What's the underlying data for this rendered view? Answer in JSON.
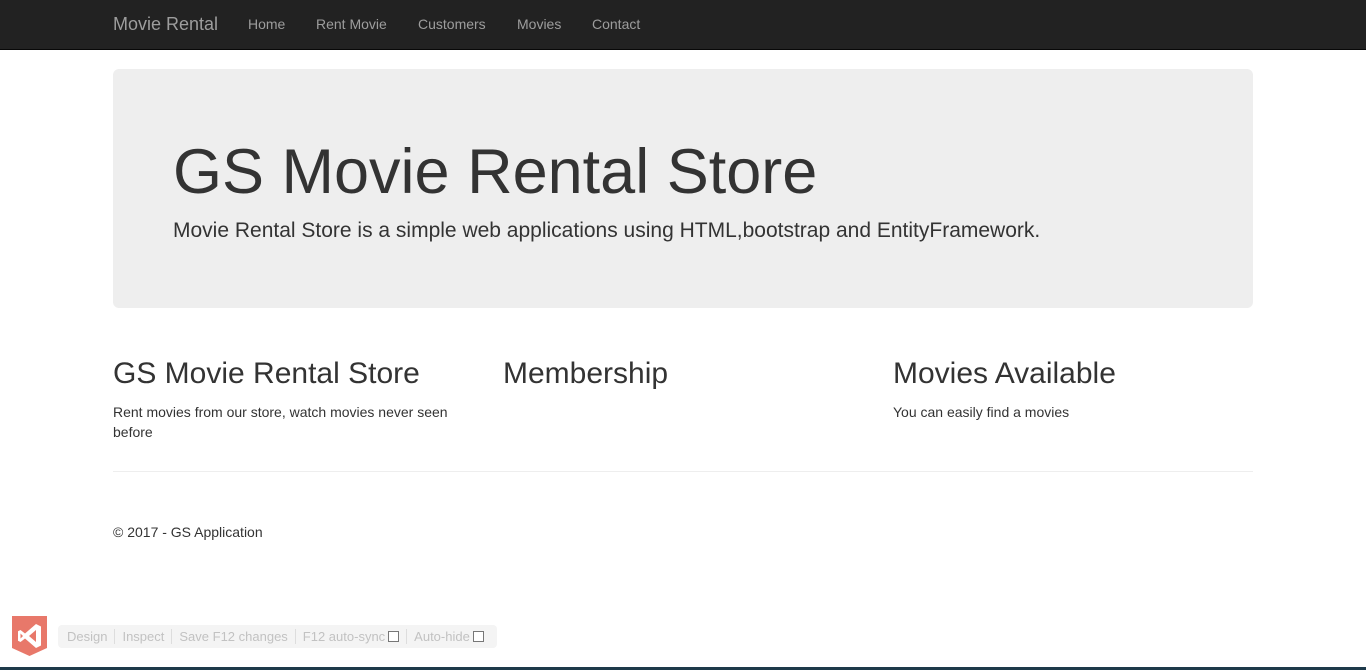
{
  "navbar": {
    "brand": "Movie Rental",
    "links": [
      "Home",
      "Rent Movie",
      "Customers",
      "Movies",
      "Contact"
    ]
  },
  "jumbotron": {
    "title": "GS Movie Rental Store",
    "lead": "Movie Rental Store is a simple web applications using HTML,bootstrap and EntityFramework."
  },
  "columns": [
    {
      "heading": "GS Movie Rental Store",
      "text": "Rent movies from our store, watch movies never seen before"
    },
    {
      "heading": "Membership",
      "text": ""
    },
    {
      "heading": "Movies Available",
      "text": "You can easily find a movies"
    }
  ],
  "footer": {
    "text": "© 2017 - GS Application"
  },
  "browser_link_toolbar": {
    "items": [
      "Design",
      "Inspect",
      "Save F12 changes",
      "F12 auto-sync",
      "Auto-hide"
    ],
    "auto_sync_checked": false,
    "auto_hide_checked": false
  },
  "icons": {
    "logo": "visual-studio-icon"
  },
  "colors": {
    "navbar_bg": "#222222",
    "nav_text": "#9d9d9d",
    "jumbotron_bg": "#eeeeee",
    "text": "#333333",
    "vs_logo": "#e8786a"
  }
}
